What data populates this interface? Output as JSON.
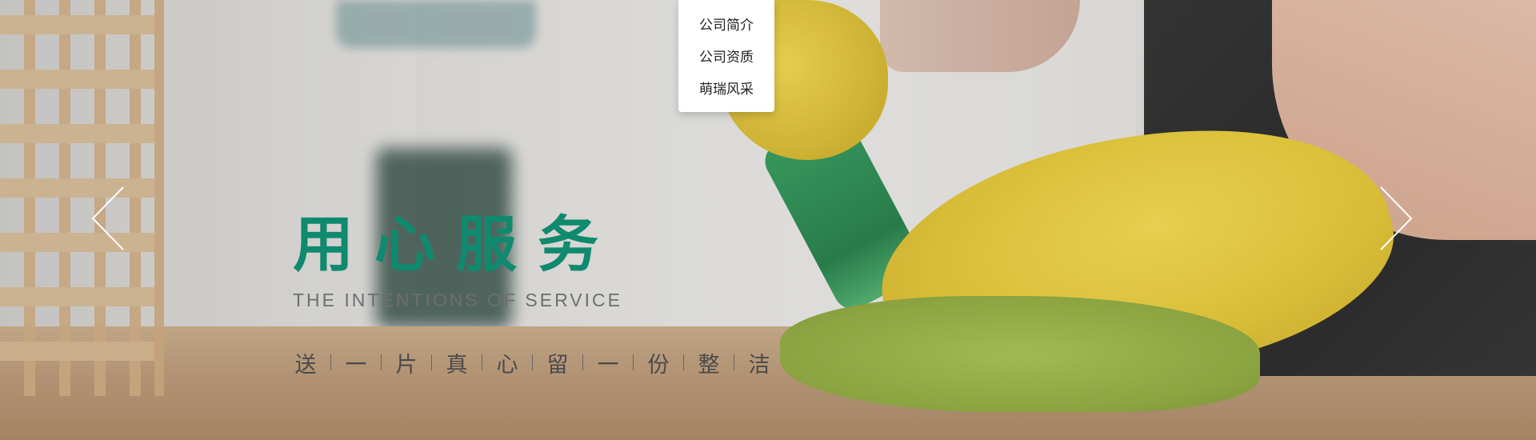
{
  "dropdown": {
    "items": [
      "公司简介",
      "公司资质",
      "萌瑞风采"
    ]
  },
  "banner": {
    "headline": "用心服务",
    "subline": "THE INTENTIONS OF SERVICE",
    "slogan": [
      "送",
      "一",
      "片",
      "真",
      "心",
      "留",
      "一",
      "份",
      "整",
      "洁"
    ]
  },
  "colors": {
    "headline": "#0f8a6e",
    "subline": "#6e6e6e",
    "slogan": "#4a4a4a"
  },
  "icons": {
    "prev": "chevron-left-icon",
    "next": "chevron-right-icon"
  }
}
